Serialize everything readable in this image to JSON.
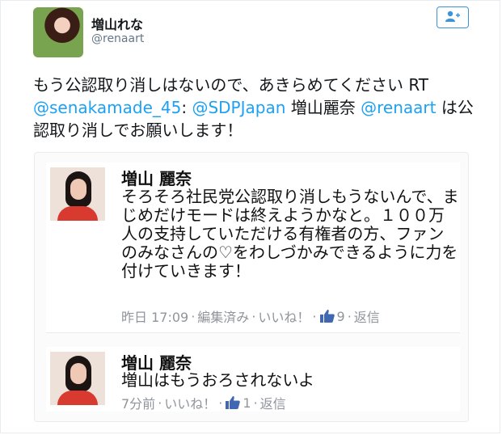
{
  "user": {
    "name": "増山れな",
    "handle": "@renaart"
  },
  "tweet": {
    "text1": "もう公認取り消しはないので、あきらめてください RT",
    "mention1": "@senakamade_45",
    "colon": ":",
    "mention2": "@SDPJapan",
    "mid": "増山麗奈",
    "mention3": "@renaart",
    "text2": "は公認取り消しでお願いします！"
  },
  "comments": [
    {
      "name": "増山 麗奈",
      "text": "そろそろ社民党公認取り消しもうないんで、まじめだけモードは終えようかなと。１００万人の支持していただける有権者の方、ファンのみなさんの♡をわしづかみできるように力を付けていきます！",
      "time": "昨日 17:09",
      "edited": "編集済み",
      "like": "いいね！",
      "count": "9",
      "reply": "返信"
    },
    {
      "name": "増山 麗奈",
      "text": "増山はもうおろされないよ",
      "time": "7分前",
      "like": "いいね！",
      "count": "1",
      "reply": "返信"
    }
  ],
  "icons": {
    "follow": "follow-user-icon",
    "like": "thumbs-up-icon"
  },
  "colors": {
    "link": "#1da1f2",
    "follow_border": "#3b94d9",
    "meta": "#90949c",
    "like_icon": "#4267b2"
  }
}
